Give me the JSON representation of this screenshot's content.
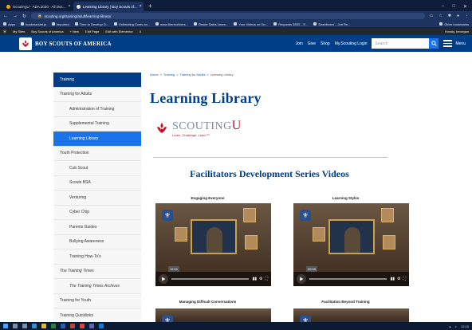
{
  "browser": {
    "tabs": [
      {
        "label": "ScoutingU - ADA 2020 - All Doc...",
        "active": false
      },
      {
        "label": "Learning Library | Boy Scouts of...",
        "active": true
      }
    ],
    "new_tab": "+",
    "url": "scouting.org/training/adult/learning-library/",
    "bookmarks": [
      "Apps",
      "bookmarklet.js",
      "Imported",
      "Time to Develop O...",
      "Estimating Costs an...",
      "www.thereceivers...",
      "Oracle Sales Learn...",
      "Your Videos on Go...",
      "Requests 3853 – E...",
      "Dashboard – Job Re...",
      "Other bookmarks"
    ],
    "wp_admin": {
      "items": [
        "My Sites",
        "Boy Scouts of America",
        "+ New",
        "Edit Page",
        "Edit with Elementor",
        "0"
      ],
      "greeting": "Howdy, bmorgan"
    }
  },
  "header": {
    "brand": "BOY SCOUTS OF AMERICA",
    "nav": [
      "Join",
      "Give",
      "Shop",
      "My.Scouting Login"
    ],
    "search_placeholder": "Search",
    "menu_label": "Menu"
  },
  "sidebar": {
    "items": [
      {
        "label": "Training",
        "level": 1,
        "style": "head"
      },
      {
        "label": "Training for Adults",
        "level": 1
      },
      {
        "label": "Administration of Training",
        "level": 2
      },
      {
        "label": "Supplemental Training",
        "level": 2
      },
      {
        "label": "Learning Library",
        "level": 2,
        "style": "active"
      },
      {
        "label": "Youth Protection",
        "level": 1
      },
      {
        "label": "Cub Scout",
        "level": 2
      },
      {
        "label": "Scouts BSA",
        "level": 2
      },
      {
        "label": "Venturing",
        "level": 2
      },
      {
        "label": "Cyber Chip",
        "level": 2
      },
      {
        "label": "Parents Guides",
        "level": 2
      },
      {
        "label": "Bullying Awareness",
        "level": 2
      },
      {
        "label": "Training How-To's",
        "level": 2
      },
      {
        "label": "The Training Times",
        "level": 1,
        "italic": true
      },
      {
        "label": "The Training Times Archives",
        "level": 2,
        "italic": true
      },
      {
        "label": "Training for Youth",
        "level": 1
      },
      {
        "label": "Training Quicklinks",
        "level": 1
      }
    ]
  },
  "breadcrumb": {
    "home": "Home",
    "sep": "»",
    "training": "Training",
    "adults": "Training for Adults",
    "current": "Learning Library"
  },
  "page": {
    "title": "Learning Library",
    "logo_word": "SCOUTING",
    "logo_u": "U",
    "logo_tagline": "Learn. Challenge. Lead.™",
    "section_title": "Facilitators Development Series Videos"
  },
  "videos": [
    {
      "title": "Engaging Everyone",
      "time": "12:01"
    },
    {
      "title": "Learning Styles",
      "time": "09:45"
    },
    {
      "title": "Managing Difficult Conversations"
    },
    {
      "title": "Facilitation Beyond Training"
    }
  ],
  "taskbar": {
    "clock": "12:15"
  }
}
